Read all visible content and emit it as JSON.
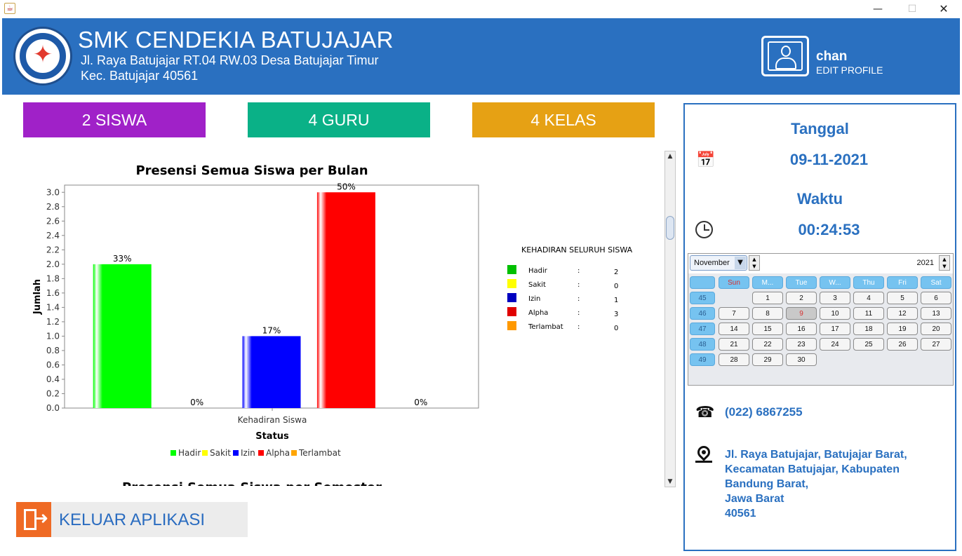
{
  "window": {
    "minimize": "—",
    "maximize": "☐",
    "close": "✕"
  },
  "header": {
    "school_name": "SMK CENDEKIA BATUJAJAR",
    "address_line1": "Jl. Raya Batujajar RT.04 RW.03 Desa Batujajar Timur",
    "address_line2": "Kec. Batujajar 40561",
    "user_name": "chan",
    "edit_profile": "EDIT PROFILE"
  },
  "stats": {
    "siswa": "2 SISWA",
    "guru": "4 GURU",
    "kelas": "4 KELAS"
  },
  "chart_data": {
    "type": "bar",
    "title": "Presensi Semua Siswa per Bulan",
    "xlabel": "Status",
    "ylabel": "Jumlah",
    "category_label": "Kehadiran Siswa",
    "ylim": [
      0,
      3.1
    ],
    "yticks": [
      "0.0",
      "0.2",
      "0.4",
      "0.6",
      "0.8",
      "1.0",
      "1.2",
      "1.4",
      "1.6",
      "1.8",
      "2.0",
      "2.2",
      "2.4",
      "2.6",
      "2.8",
      "3.0"
    ],
    "series": [
      {
        "name": "Hadir",
        "value": 2,
        "label": "33%",
        "color": "#00ff00"
      },
      {
        "name": "Sakit",
        "value": 0,
        "label": "0%",
        "color": "#ffff00"
      },
      {
        "name": "Izin",
        "value": 1,
        "label": "17%",
        "color": "#0000ff"
      },
      {
        "name": "Alpha",
        "value": 3,
        "label": "50%",
        "color": "#ff0000"
      },
      {
        "name": "Terlambat",
        "value": 0,
        "label": "0%",
        "color": "#ffa500"
      }
    ],
    "side_legend": {
      "title": "KEHADIRAN SELURUH SISWA",
      "items": [
        {
          "name": "Hadir",
          "sep": ":",
          "count": "2",
          "color": "#00c000"
        },
        {
          "name": "Sakit",
          "sep": ":",
          "count": "0",
          "color": "#ffff00"
        },
        {
          "name": "Izin",
          "sep": ":",
          "count": "1",
          "color": "#0000c0"
        },
        {
          "name": "Alpha",
          "sep": ":",
          "count": "3",
          "color": "#e00000"
        },
        {
          "name": "Terlambat",
          "sep": ":",
          "count": "0",
          "color": "#ff9900"
        }
      ]
    },
    "next_title": "Presensi Semua Siswa per Semester"
  },
  "exit": {
    "label": "KELUAR APLIKASI"
  },
  "right_panel": {
    "tanggal_label": "Tanggal",
    "tanggal_value": "09-11-2021",
    "waktu_label": "Waktu",
    "waktu_value": "00:24:53",
    "phone": "(022) 6867255",
    "address": [
      "Jl. Raya Batujajar, Batujajar Barat,",
      "Kecamatan Batujajar, Kabupaten",
      "Bandung Barat,",
      "Jawa Barat",
      "40561"
    ]
  },
  "calendar": {
    "month": "November",
    "year": "2021",
    "day_headers": [
      "Sun",
      "M...",
      "Tue",
      "W...",
      "Thu",
      "Fri",
      "Sat"
    ],
    "today": 9,
    "weeks": [
      {
        "week": "45",
        "days": [
          "",
          "1",
          "2",
          "3",
          "4",
          "5",
          "6"
        ]
      },
      {
        "week": "46",
        "days": [
          "7",
          "8",
          "9",
          "10",
          "11",
          "12",
          "13"
        ]
      },
      {
        "week": "47",
        "days": [
          "14",
          "15",
          "16",
          "17",
          "18",
          "19",
          "20"
        ]
      },
      {
        "week": "48",
        "days": [
          "21",
          "22",
          "23",
          "24",
          "25",
          "26",
          "27"
        ]
      },
      {
        "week": "49",
        "days": [
          "28",
          "29",
          "30",
          "",
          "",
          "",
          ""
        ]
      }
    ]
  }
}
